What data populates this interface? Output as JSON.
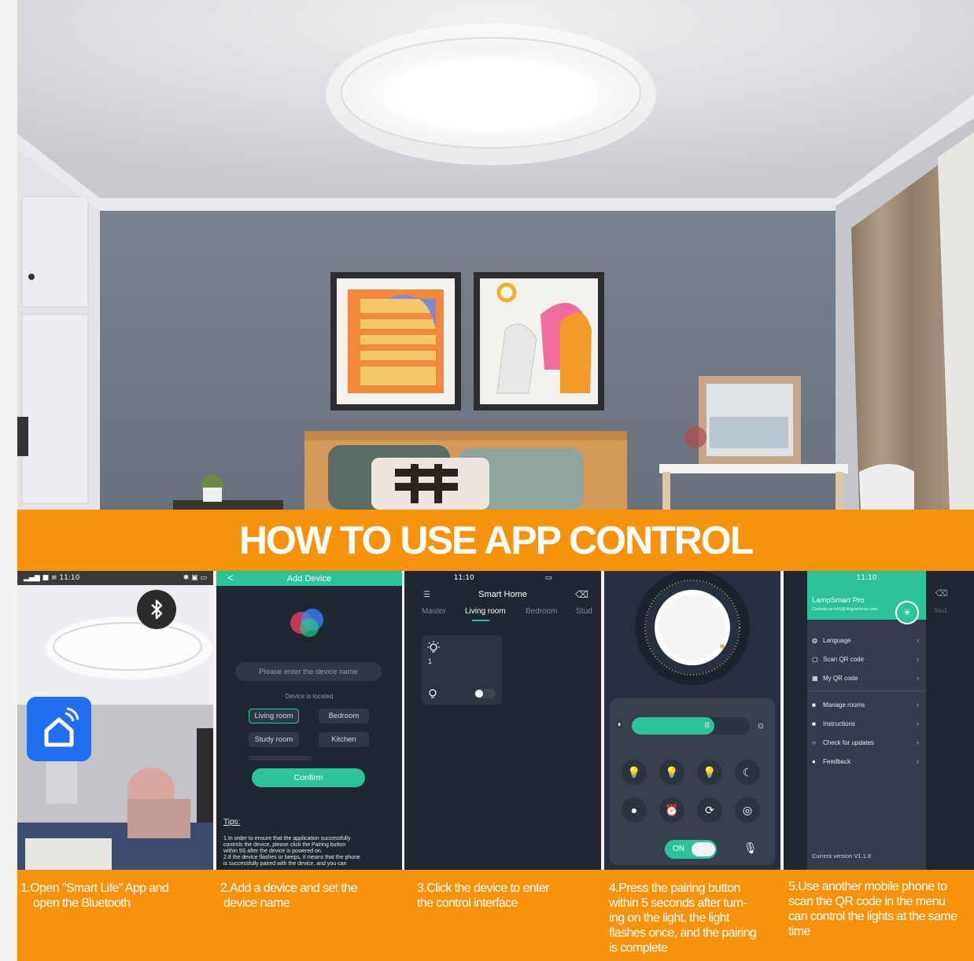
{
  "banner": {
    "title": "HOW TO USE APP CONTROL"
  },
  "steps": [
    {
      "number": "1.",
      "line1": "Open \"Smart Life\" App and",
      "line2": "open the Bluetooth"
    },
    {
      "number": "2.",
      "line1": "Add a device and set the",
      "line2": "device name"
    },
    {
      "number": "3.",
      "line1": "Click the device to enter",
      "line2": "the control interface"
    },
    {
      "number": "4.",
      "lines": [
        "Press the pairing button",
        "within 5 seconds after turn-",
        "ing on the light, the light",
        "flashes once, and the pairing",
        "is complete"
      ]
    },
    {
      "number": "5.",
      "lines": [
        "Use another mobile phone to",
        "scan the QR code in the menu",
        "can control the lights at the same",
        "time"
      ]
    }
  ],
  "panel1": {
    "time": "11:10",
    "signal": "▂▄▆ ■ ≡ 11:10",
    "right_icons": "✱ ▣ ▭",
    "bluetooth_icon": "bluetooth-icon",
    "app_icon": "smart-life-home-icon"
  },
  "panel2": {
    "title": "Add Device",
    "back": "<",
    "name_placeholder": "Please enter the device name",
    "located_label": "Device is located",
    "rooms": [
      "Living room",
      "Bedroom",
      "Study room",
      "Kitchen"
    ],
    "selected_room": "Living room",
    "confirm": "Confirm",
    "tips_title": "Tips:",
    "tips": [
      "1.In order to ensure that the application successfully",
      "controls the device, please click the Pairing button",
      "within 5S after the device is powered on.",
      "2.If the device flashes or beeps, it means that the phone",
      "is successfully paired with the device, and you can"
    ]
  },
  "panel3": {
    "time": "11:10",
    "title": "Smart Home",
    "tabs": [
      "Master",
      "Living room",
      "Bedroom",
      "Stud"
    ],
    "active_tab": "Living room",
    "device_number": "1"
  },
  "panel4": {
    "brightness": 0.7,
    "on_label": "ON",
    "modes": [
      "bulb-icon",
      "bulb-icon",
      "bulb-icon",
      "moon-icon",
      "bulb-filled-icon",
      "alarm-icon",
      "scene-icon",
      "fingerprint-icon"
    ]
  },
  "panel5": {
    "time": "11:10",
    "app_name": "LampSmart Pro",
    "contact": "Contact us:info@Jingusmicro.com",
    "side_label": "Stud",
    "menu_group1": [
      {
        "icon": "◍",
        "label": "Language"
      },
      {
        "icon": "▢",
        "label": "Scan QR code"
      },
      {
        "icon": "▦",
        "label": "My QR code"
      }
    ],
    "menu_group2": [
      {
        "icon": "■",
        "label": "Manage rooms"
      },
      {
        "icon": "■",
        "label": "Instructions"
      },
      {
        "icon": "○",
        "label": "Check for updates"
      },
      {
        "icon": "●",
        "label": "Feedback"
      }
    ],
    "version": "Current version V1.1.8"
  },
  "colors": {
    "accent_orange": "#f7920d",
    "app_green": "#2cc29a",
    "app_dark": "#1f2732"
  }
}
